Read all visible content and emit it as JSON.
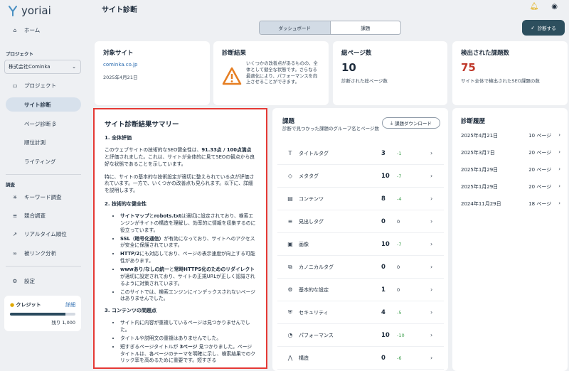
{
  "app": {
    "logo_text": "yoriai",
    "page_title": "サイト診断"
  },
  "sidebar": {
    "home": "ホーム",
    "project_label": "プロジェクト",
    "project_select": "株式会社Cominka",
    "items": [
      {
        "label": "プロジェクト"
      },
      {
        "label": "サイト診断"
      },
      {
        "label": "ページ診断 β"
      },
      {
        "label": "順位計測"
      },
      {
        "label": "ライティング"
      }
    ],
    "research_label": "調査",
    "research_items": [
      {
        "label": "キーワード調査"
      },
      {
        "label": "競合調査"
      },
      {
        "label": "リアルタイム順位"
      },
      {
        "label": "被リンク分析"
      }
    ],
    "settings": "設定",
    "credit": {
      "label": "クレジット",
      "detail": "詳細",
      "remaining": "残り 1,000",
      "fill": 0.85
    }
  },
  "header": {
    "tabs": [
      "ダッシュボード",
      "課題"
    ],
    "diagnose_button": "診断する"
  },
  "cards": {
    "site": {
      "title": "対象サイト",
      "url": "cominka.co.jp",
      "date": "2025年4月21日"
    },
    "result": {
      "title": "診断結果",
      "text": "いくつかの改善点があるものの、全体として健全な状態です。さらなる最適化により、パフォーマンスを向上させることができます。"
    },
    "pages": {
      "title": "総ページ数",
      "value": "10",
      "caption": "診断された総ページ数"
    },
    "issues": {
      "title": "検出された課題数",
      "value": "75",
      "caption": "サイト全体で検出されたSEO課題の数"
    }
  },
  "summary": {
    "title": "サイト診断結果サマリー",
    "h1": "1. 全体評価",
    "p1a": "このウェブサイトの技術的なSEO健全性は、",
    "p1b": "91.33点 / 100点満点",
    "p1c": " と評価されました。これは、サイトが全体的に見てSEOの観点から良好な状態であることを示しています。",
    "p2": "特に、サイトの基本的な技術設定が適切に整えられている点が評価されています。一方で、いくつかの改善点も見られます。以下に、詳細を説明します。",
    "h2": "2. 技術的な健全性",
    "b1a": "サイトマップ",
    "b1b": "と",
    "b1c": "robots.txt",
    "b1d": "は適切に設定されており、検索エンジンがサイトの構造を理解し、効率的に情報を収集するのに役立っています。",
    "b2a": "SSL（暗号化通信）",
    "b2b": "が有効になっており、サイトへのアクセスが安全に保護されています。",
    "b3a": "HTTP/2",
    "b3b": "にも対応しており、ページの表示速度が向上する可能性があります。",
    "b4a": "wwwあり/なしの統一",
    "b4b": "と",
    "b4c": "常時HTTPS化のためのリダイレクト",
    "b4d": "が適切に設定されており、サイトの正規URLが正しく認識されるように対策されています。",
    "b5": "このサイトでは、検索エンジンにインデックスされないページはありませんでした。",
    "h3": "3. コンテンツの問題点",
    "c1": "サイト内に内容が重複しているページは見つかりませんでした。",
    "c2": "タイトルや説明文の重複はありませんでした。",
    "c3a": "短すぎるページタイトルが ",
    "c3b": "3ページ",
    "c3c": " 見つかりました。ページタイトルは、各ページのテーマを明確に示し、検索結果でのクリック率を高めるために重要です。短すぎる"
  },
  "issues": {
    "title": "課題",
    "subtitle": "診断で見つかった課題のグループ名とページ数",
    "download": "課題ダウンロード",
    "rows": [
      {
        "icon": "T",
        "name": "タイトルタグ",
        "count": "3",
        "delta": "-1",
        "color": "#3a9d4a"
      },
      {
        "icon": "◇",
        "name": "メタタグ",
        "count": "10",
        "delta": "-7",
        "color": "#3a9d4a"
      },
      {
        "icon": "▤",
        "name": "コンテンツ",
        "count": "8",
        "delta": "-4",
        "color": "#3a9d4a"
      },
      {
        "icon": "≡",
        "name": "見出しタグ",
        "count": "0",
        "delta": "0",
        "color": "#1f2d3d"
      },
      {
        "icon": "▣",
        "name": "画像",
        "count": "10",
        "delta": "-7",
        "color": "#3a9d4a"
      },
      {
        "icon": "⧉",
        "name": "カノニカルタグ",
        "count": "0",
        "delta": "0",
        "color": "#1f2d3d"
      },
      {
        "icon": "⚙",
        "name": "基本的な設定",
        "count": "1",
        "delta": "0",
        "color": "#1f2d3d"
      },
      {
        "icon": "⛨",
        "name": "セキュリティ",
        "count": "4",
        "delta": "-5",
        "color": "#3a9d4a"
      },
      {
        "icon": "◔",
        "name": "パフォーマンス",
        "count": "10",
        "delta": "-10",
        "color": "#3a9d4a"
      },
      {
        "icon": "⋀",
        "name": "構造",
        "count": "0",
        "delta": "-6",
        "color": "#3a9d4a"
      }
    ]
  },
  "history": {
    "title": "診断履歴",
    "rows": [
      {
        "date": "2025年4月21日",
        "pages": "10 ページ"
      },
      {
        "date": "2025年3月7日",
        "pages": "20 ページ"
      },
      {
        "date": "2025年1月29日",
        "pages": "20 ページ"
      },
      {
        "date": "2025年1月29日",
        "pages": "20 ページ"
      },
      {
        "date": "2024年11月29日",
        "pages": "18 ページ"
      }
    ]
  }
}
